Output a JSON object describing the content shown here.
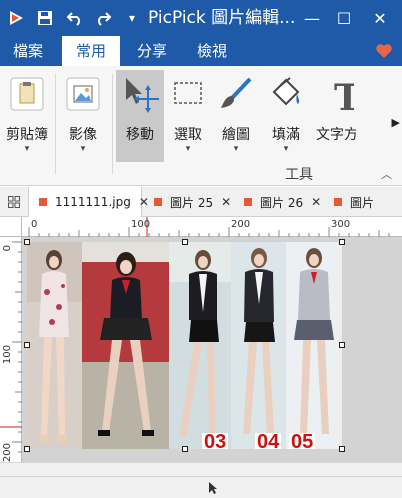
{
  "app": {
    "title": "PicPick 圖片編輯..."
  },
  "window_controls": {
    "minimize": "—",
    "maximize": "☐",
    "close": "✕"
  },
  "quick_access": {
    "save_icon": "save-icon",
    "undo_icon": "undo-icon",
    "redo_icon": "redo-icon",
    "customize": "▾"
  },
  "ribbon_tabs": [
    {
      "label": "檔案",
      "active": false
    },
    {
      "label": "常用",
      "active": true
    },
    {
      "label": "分享",
      "active": false
    },
    {
      "label": "檢視",
      "active": false
    }
  ],
  "ribbon": {
    "clipboard_label": "剪貼簿",
    "image_label": "影像",
    "move_label": "移動",
    "select_label": "選取",
    "draw_label": "繪圖",
    "fill_label": "填滿",
    "text_label": "文字方",
    "caret": "▾",
    "tools_group_label": "工具",
    "scroll_arrow": "▶",
    "collapse_arrow": "︿"
  },
  "document_tabs": [
    {
      "label": "1111111.jpg",
      "active": true,
      "close": "✕"
    },
    {
      "label": "圖片 25",
      "active": false,
      "close": "✕"
    },
    {
      "label": "圖片 26",
      "active": false,
      "close": "✕"
    },
    {
      "label": "圖片",
      "active": false,
      "close": ""
    }
  ],
  "ruler": {
    "top": [
      "0",
      "100",
      "200",
      "300"
    ],
    "left": [
      "0",
      "100",
      "200"
    ]
  },
  "image_labels": [
    "03",
    "04",
    "05"
  ],
  "colors": {
    "titlebar": "#1e5aa8",
    "accent_red": "#cc1111",
    "heart": "#e8644a",
    "tab_marker": "#e25b34"
  }
}
